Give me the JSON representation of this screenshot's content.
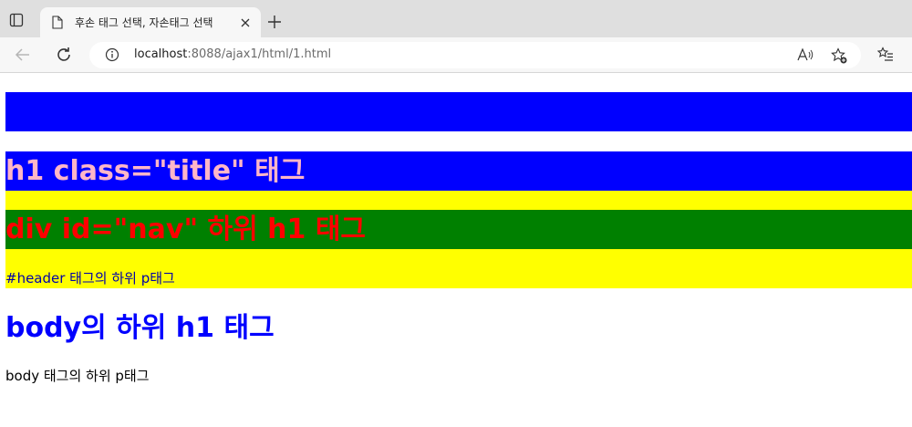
{
  "browser": {
    "tab_title": "후손 태그 선택, 자손태그 선택",
    "url_host": "localhost",
    "url_path": ":8088/ajax1/html/1.html"
  },
  "page": {
    "title_h1": "h1 class=\"title\" 태그",
    "nav_h1": "div id=\"nav\" 하위 h1 태그",
    "header_p": "#header 태그의 하위 p태그",
    "body_h1": "body의 하위 h1 태그",
    "body_p": "body 태그의 하위 p태그"
  },
  "colors": {
    "blue": "#0000ff",
    "pink": "#ffb6c8",
    "yellow": "#ffff00",
    "green": "#008000",
    "red": "#ff0000"
  },
  "icons": [
    "tab-actions-icon",
    "page-icon",
    "close-icon",
    "plus-icon",
    "back-arrow-icon",
    "refresh-icon",
    "info-icon",
    "read-aloud-icon",
    "add-favorite-icon",
    "favorites-icon"
  ]
}
